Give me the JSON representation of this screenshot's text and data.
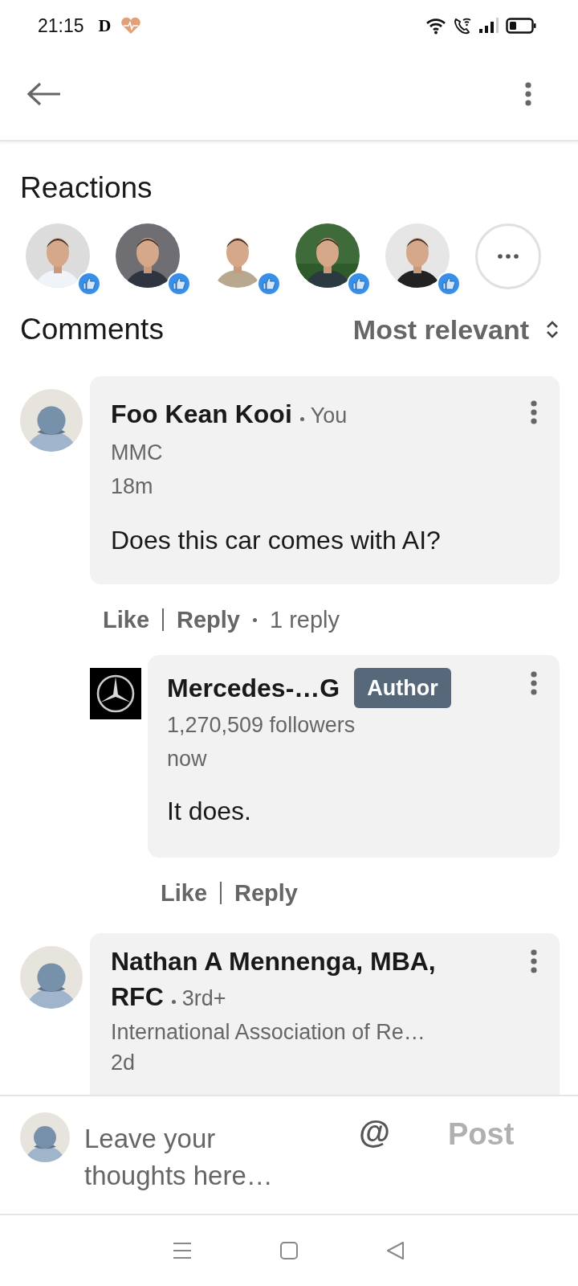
{
  "status_bar": {
    "time": "21:15",
    "app_letter": "D"
  },
  "reactions": {
    "title": "Reactions"
  },
  "comments_header": {
    "title": "Comments",
    "sort": "Most relevant"
  },
  "comments": [
    {
      "kind": "member",
      "name": "Foo Kean Kooi",
      "relation": "You",
      "headline": "MMC",
      "time": "18m",
      "text": "Does this car comes with AI?",
      "actions": [
        "Like",
        "Reply"
      ],
      "reply_count": "1 reply",
      "replies": [
        {
          "kind": "company",
          "name": "Mercedes-…G",
          "badge": "Author",
          "headline": "1,270,509 followers",
          "time": "now",
          "text": "It does.",
          "actions": [
            "Like",
            "Reply"
          ]
        }
      ]
    },
    {
      "kind": "member",
      "name": "Nathan A Mennenga, MBA, RFC",
      "relation": "3rd+",
      "headline": "International Association of Re…",
      "time": "2d"
    }
  ],
  "composer": {
    "placeholder": "Leave your thoughts here…",
    "mention": "@",
    "post": "Post",
    "post_disabled": true
  }
}
